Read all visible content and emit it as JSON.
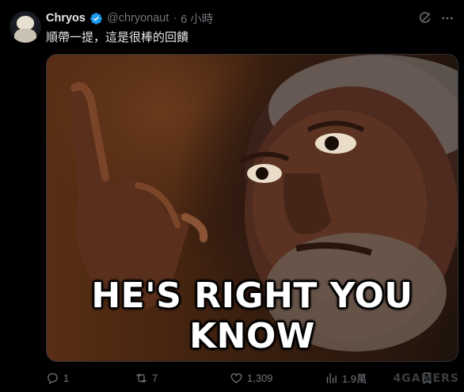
{
  "tweet": {
    "author": {
      "name": "Chryos",
      "handle": "@chryonaut",
      "verified": true,
      "avatar_icon": "avatar-icon"
    },
    "separator": "·",
    "timestamp": "6 小時",
    "text": "順帶一提，這是很棒的回饋",
    "media": {
      "caption": "HE'S RIGHT YOU KNOW"
    }
  },
  "actions": {
    "reply": {
      "icon": "reply-icon",
      "count": "1"
    },
    "retweet": {
      "icon": "retweet-icon",
      "count": "7"
    },
    "like": {
      "icon": "heart-icon",
      "count": "1,309"
    },
    "views": {
      "icon": "analytics-icon",
      "count": "1.9萬"
    },
    "bookmark": {
      "icon": "bookmark-icon"
    }
  },
  "watermark": "4GAMERS",
  "colors": {
    "background": "#000000",
    "text": "#e7e9ea",
    "muted": "#71767b",
    "verified": "#1d9bf0"
  }
}
